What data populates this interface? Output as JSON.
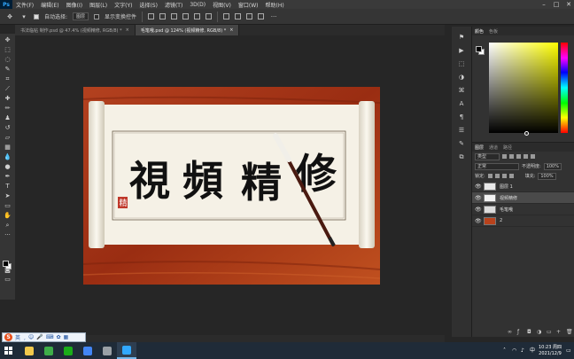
{
  "menubar": {
    "app_logo": "Ps",
    "items": [
      "文件(F)",
      "编辑(E)",
      "图像(I)",
      "图层(L)",
      "文字(Y)",
      "选择(S)",
      "滤镜(T)",
      "3D(D)",
      "视图(V)",
      "窗口(W)",
      "帮助(H)"
    ]
  },
  "options": {
    "auto_select_label": "自动选择:",
    "auto_select_value": "图层",
    "show_transform_label": "显示变换控件"
  },
  "tabs": [
    {
      "label": "书法临帖 制作.psd @ 47.4% (视频精修, RGB/8) *",
      "close": "×"
    },
    {
      "label": "毛笔哦.psd @ 124% (视频精修, RGB/8) *",
      "close": "×"
    }
  ],
  "canvas": {
    "characters": [
      "視",
      "頻",
      "精",
      "修"
    ],
    "seal_text": "精"
  },
  "right_panel": {
    "color_tabs": [
      "颜色",
      "色板"
    ],
    "layer_tabs": [
      "图层",
      "通道",
      "路径"
    ],
    "kind_label": "类型",
    "blend_mode": "正常",
    "opacity_label": "不透明度:",
    "opacity_value": "100%",
    "lock_label": "锁定:",
    "fill_label": "填充:",
    "fill_value": "100%",
    "layers": [
      {
        "name": "图层 1",
        "thumb": "#e8e8e8",
        "selected": false
      },
      {
        "name": "视频精修",
        "thumb": "#f2f2f2",
        "selected": true
      },
      {
        "name": "毛笔哦",
        "thumb": "#dcdcdc",
        "selected": false
      },
      {
        "name": "2",
        "thumb": "#b8421c",
        "selected": false
      }
    ]
  },
  "ime": {
    "logo": "S",
    "mode": "英"
  },
  "taskbar": {
    "apps": [
      {
        "color": "#f2c94c"
      },
      {
        "color": "#3fae49"
      },
      {
        "color": "#1aad19"
      },
      {
        "color": "#4285f4"
      },
      {
        "color": "#9aa0a6"
      },
      {
        "color": "#31a8ff"
      }
    ],
    "time": "10:23 周四",
    "date": "2021/12/9"
  },
  "colors": {
    "ps_blue": "#31a8ff",
    "wood": "#a8341a",
    "paper": "#f5f1e6"
  }
}
